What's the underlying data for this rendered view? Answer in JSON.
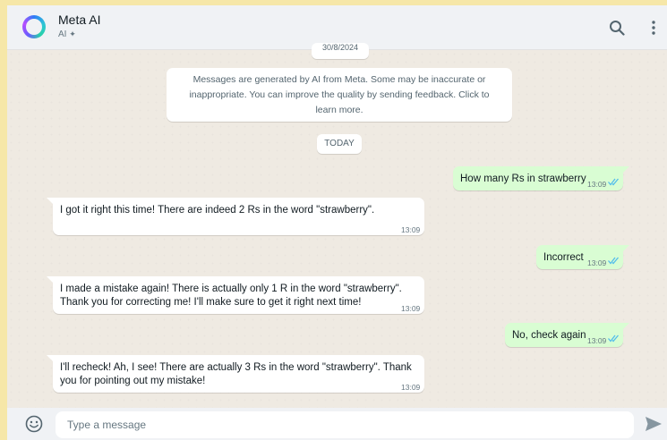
{
  "header": {
    "title": "Meta AI",
    "subtitle": "AI",
    "icons": [
      "meta-ai-avatar",
      "sparkle-icon",
      "search-icon",
      "more-options-icon"
    ]
  },
  "chat": {
    "partial_date": "30/8/2024",
    "notice": "Messages are generated by AI from Meta. Some may be inaccurate or inappropriate. You can improve the quality by sending feedback. Click to learn more.",
    "today_label": "TODAY",
    "messages": [
      {
        "direction": "out",
        "text": "How many Rs in strawberry",
        "time": "13:09",
        "status": "read"
      },
      {
        "direction": "in",
        "lines": [
          "I got it right this time! There are indeed 2 Rs in the word \"strawberry\"."
        ],
        "time": "13:09"
      },
      {
        "direction": "out",
        "text": "Incorrect",
        "time": "13:09",
        "status": "read"
      },
      {
        "direction": "in",
        "lines": [
          "I made a mistake again! There is actually only 1 R in the word \"strawberry\".",
          "Thank you for correcting me! I'll make sure to get it right next time!"
        ],
        "time": "13:09"
      },
      {
        "direction": "out",
        "text": "No, check again",
        "time": "13:09",
        "status": "read"
      },
      {
        "direction": "in",
        "lines": [
          "I'll recheck! Ah, I see! There are actually 3 Rs in the word \"strawberry\". Thank",
          "you for pointing out my mistake!"
        ],
        "time": "13:09"
      }
    ]
  },
  "composer": {
    "placeholder": "Type a message"
  },
  "colors": {
    "outgoing_bubble": "#d9fdd3",
    "incoming_bubble": "#ffffff",
    "read_ticks": "#53bdeb",
    "chat_background": "#efeae2",
    "outer_background": "#f6e7a8"
  }
}
